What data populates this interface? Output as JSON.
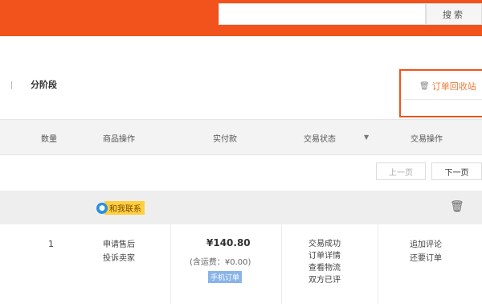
{
  "search": {
    "value": "",
    "button_label": "搜索"
  },
  "tabs": {
    "installment": "分阶段",
    "recycle_bin": "订单回收站"
  },
  "table_header": {
    "quantity": "数量",
    "goods_ops": "商品操作",
    "paid": "实付款",
    "status": "交易状态",
    "status_caret": "▼",
    "actions": "交易操作"
  },
  "pager": {
    "prev": "上一页",
    "next": "下一页"
  },
  "order": {
    "contact_label": "和我联系",
    "quantity": "1",
    "goods_ops": [
      "申请售后",
      "投诉卖家"
    ],
    "price": "¥140.80",
    "shipping": "(含运费：¥0.00)",
    "mobile_badge": "手机订单",
    "status_links": [
      "交易成功",
      "订单详情",
      "查看物流",
      "双方已评"
    ],
    "actions": [
      "追加评论",
      "还要订单"
    ]
  },
  "colors": {
    "brand": "#f2531c",
    "highlight_border": "#f2531c",
    "link_orange": "#f07a3c"
  }
}
